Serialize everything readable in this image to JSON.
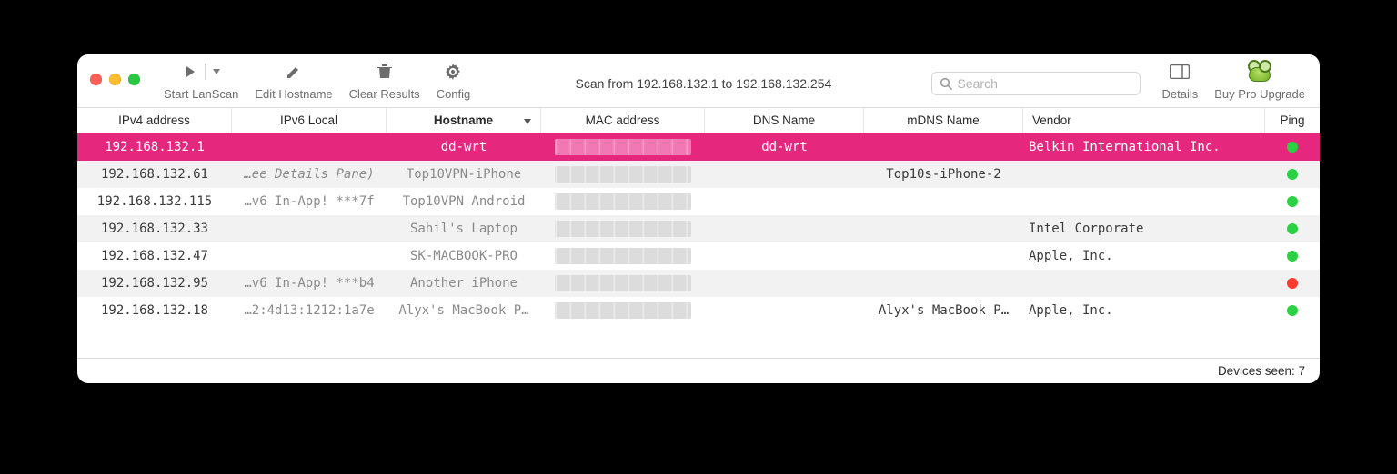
{
  "toolbar": {
    "start_label": "Start LanScan",
    "edit_label": "Edit Hostname",
    "clear_label": "Clear Results",
    "config_label": "Config",
    "details_label": "Details",
    "buy_label": "Buy Pro Upgrade",
    "scan_text": "Scan from 192.168.132.1 to 192.168.132.254",
    "search_placeholder": "Search"
  },
  "columns": {
    "ipv4": "IPv4 address",
    "ipv6": "IPv6 Local",
    "host": "Hostname",
    "mac": "MAC address",
    "dns": "DNS Name",
    "mdns": "mDNS Name",
    "vendor": "Vendor",
    "ping": "Ping",
    "sorted_by": "host"
  },
  "rows": [
    {
      "ipv4": "192.168.132.1",
      "ipv6": "",
      "ipv6_italic": false,
      "host": "dd-wrt",
      "dns": "dd-wrt",
      "mdns": "",
      "vendor": "Belkin International Inc.",
      "ping": "green",
      "selected": true
    },
    {
      "ipv4": "192.168.132.61",
      "ipv6": "…ee Details Pane)",
      "ipv6_italic": true,
      "host": "Top10VPN-iPhone",
      "dns": "",
      "mdns": "Top10s-iPhone-2",
      "vendor": "",
      "ping": "green",
      "selected": false
    },
    {
      "ipv4": "192.168.132.115",
      "ipv6": "…v6 In-App! ***7f",
      "ipv6_italic": false,
      "host": "Top10VPN Android",
      "dns": "",
      "mdns": "",
      "vendor": "",
      "ping": "green",
      "selected": false
    },
    {
      "ipv4": "192.168.132.33",
      "ipv6": "",
      "ipv6_italic": false,
      "host": "Sahil's Laptop",
      "dns": "",
      "mdns": "",
      "vendor": "Intel Corporate",
      "ping": "green",
      "selected": false
    },
    {
      "ipv4": "192.168.132.47",
      "ipv6": "",
      "ipv6_italic": false,
      "host": "SK-MACBOOK-PRO",
      "dns": "",
      "mdns": "",
      "vendor": "Apple, Inc.",
      "ping": "green",
      "selected": false
    },
    {
      "ipv4": "192.168.132.95",
      "ipv6": "…v6 In-App! ***b4",
      "ipv6_italic": false,
      "host": "Another iPhone",
      "dns": "",
      "mdns": "",
      "vendor": "",
      "ping": "red",
      "selected": false
    },
    {
      "ipv4": "192.168.132.18",
      "ipv6": "…2:4d13:1212:1a7e",
      "ipv6_italic": false,
      "host": "Alyx's MacBook P…",
      "dns": "",
      "mdns": "Alyx's MacBook P…",
      "vendor": "Apple, Inc.",
      "ping": "green",
      "selected": false
    }
  ],
  "footer": {
    "devices_seen_label": "Devices seen: 7"
  },
  "colors": {
    "selection": "#e6277e",
    "ping_green": "#2bd143",
    "ping_red": "#ff3b30"
  }
}
